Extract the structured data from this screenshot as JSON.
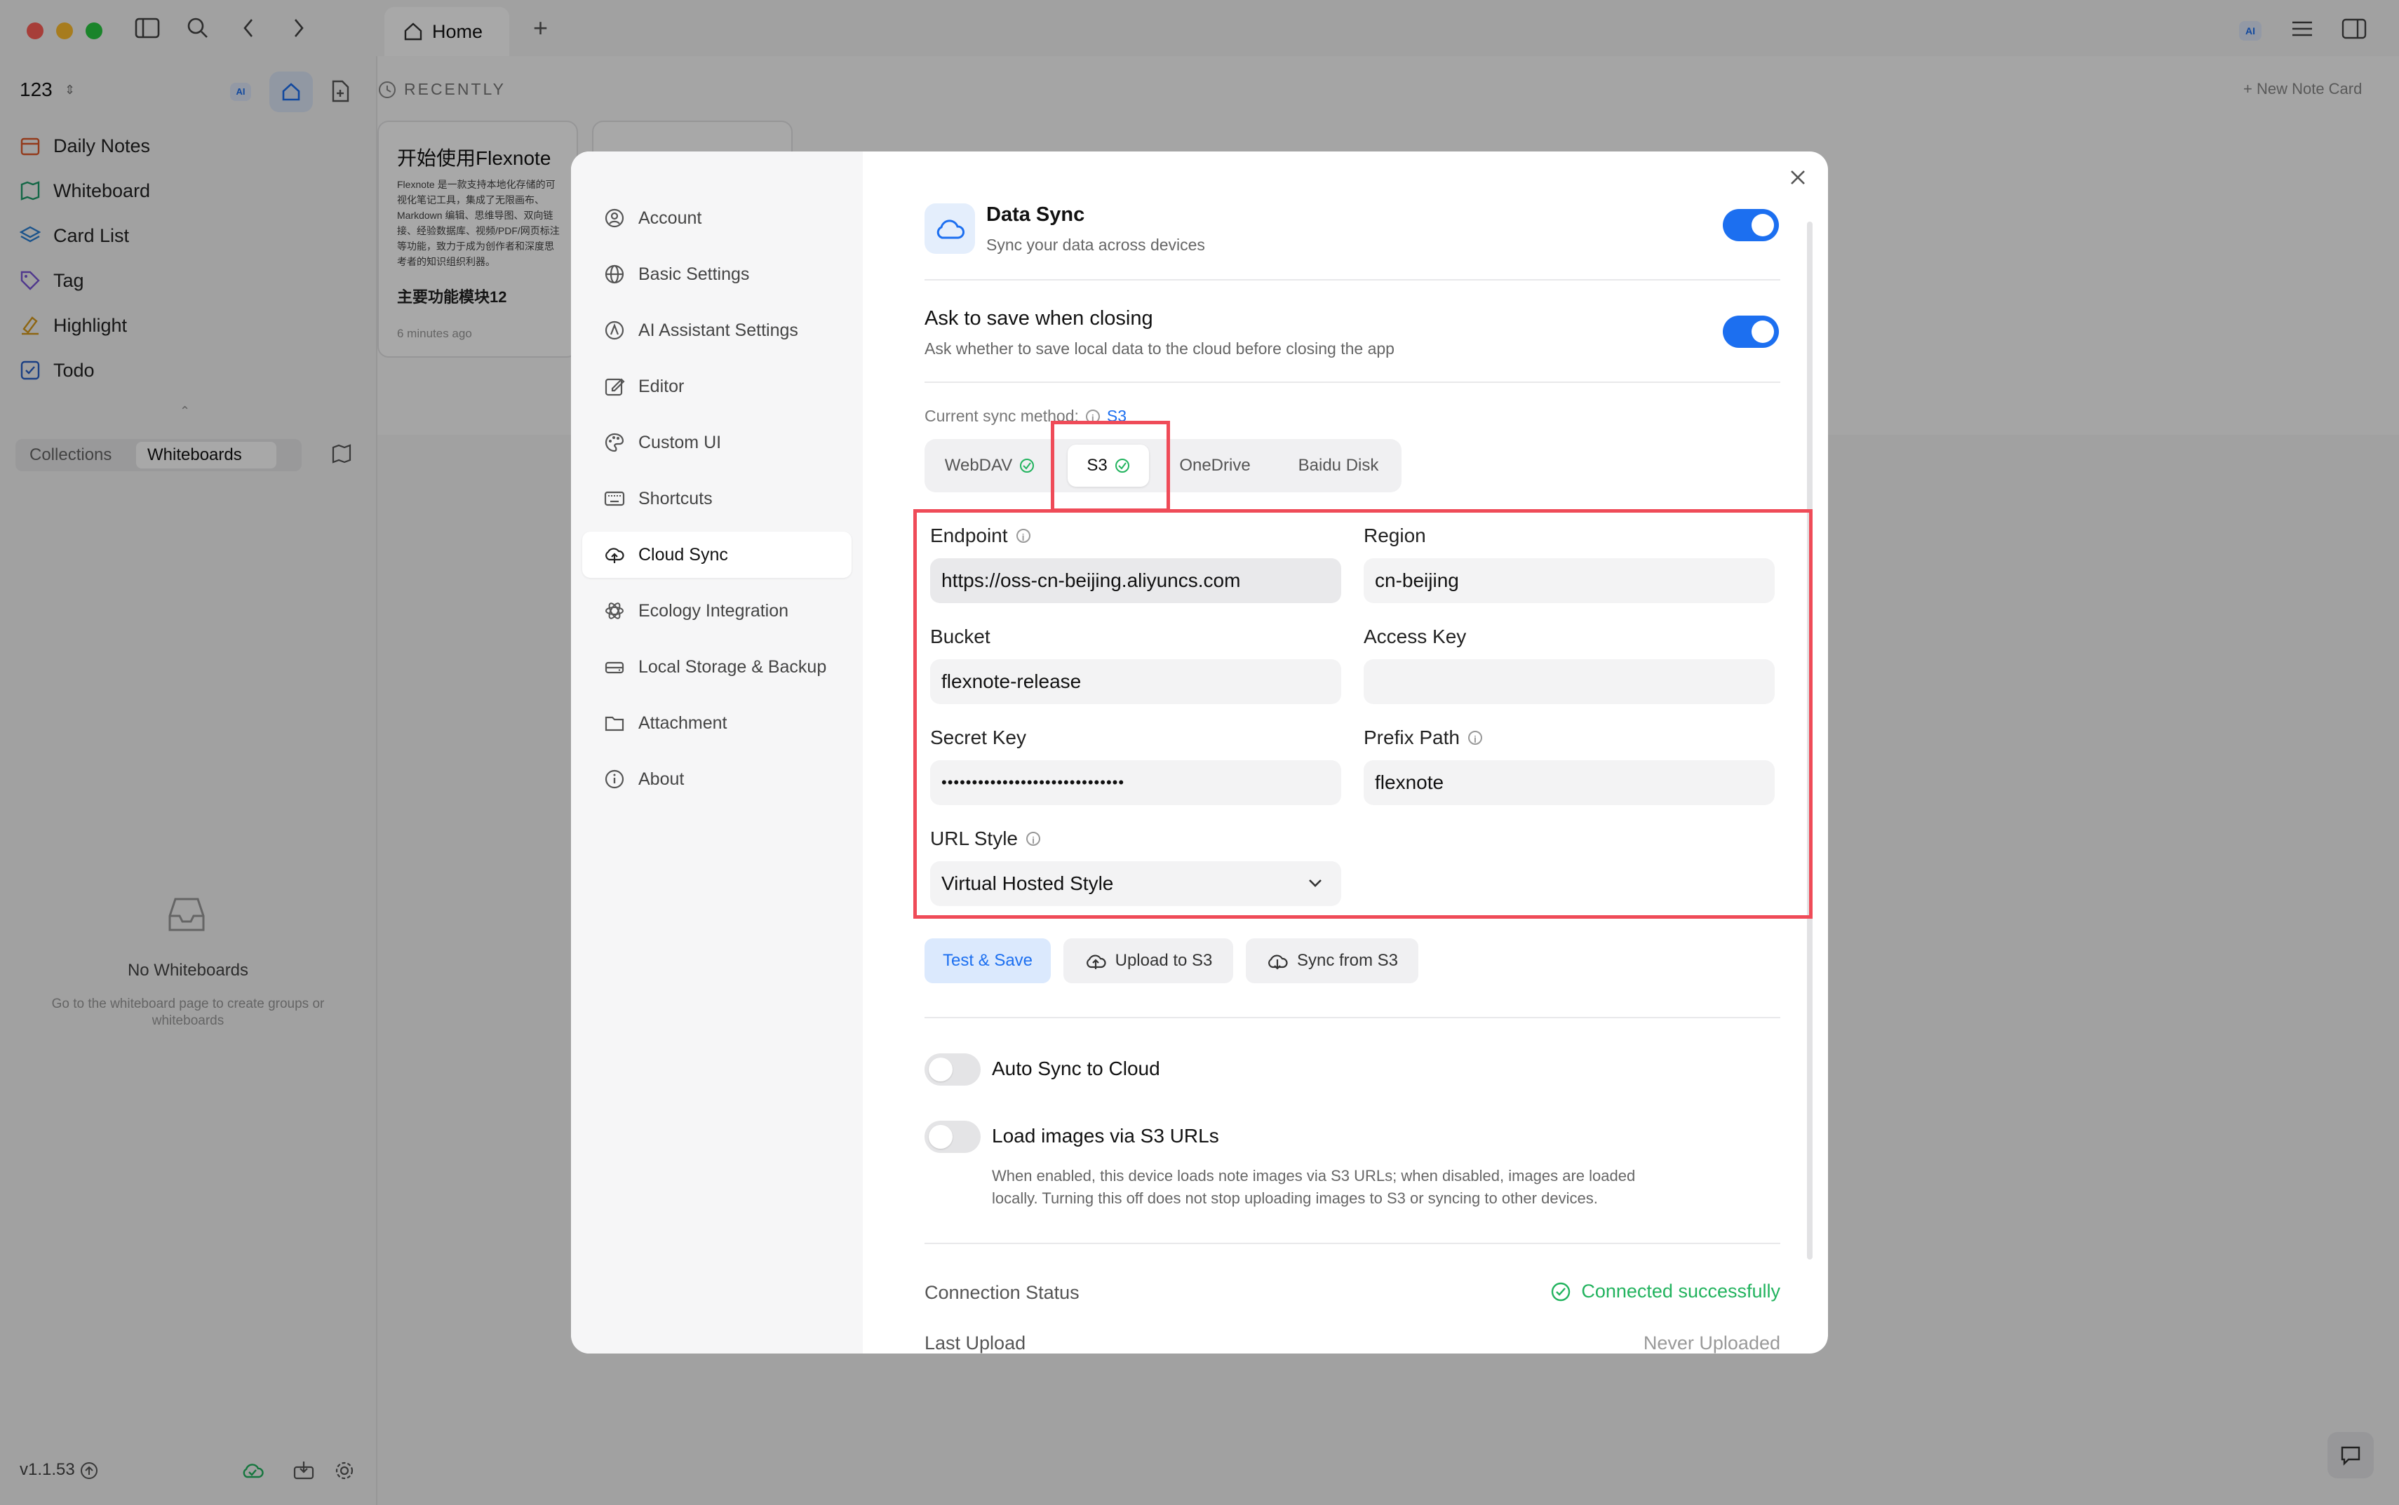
{
  "window": {
    "tab_home": "Home",
    "new_note_card": "+ New Note Card"
  },
  "sidebar": {
    "workspace": "123",
    "nav_items": [
      {
        "label": "Daily Notes",
        "icon": "calendar-icon"
      },
      {
        "label": "Whiteboard",
        "icon": "map-icon"
      },
      {
        "label": "Card List",
        "icon": "layers-icon"
      },
      {
        "label": "Tag",
        "icon": "tag-icon"
      },
      {
        "label": "Highlight",
        "icon": "highlighter-icon"
      },
      {
        "label": "Todo",
        "icon": "checkbox-icon"
      }
    ],
    "tabs": {
      "collections": "Collections",
      "whiteboards": "Whiteboards"
    },
    "empty_title": "No Whiteboards",
    "empty_desc": "Go to the whiteboard page to create groups or whiteboards",
    "version": "v1.1.53"
  },
  "main": {
    "recently_label": "RECENTLY",
    "card": {
      "title": "开始使用Flexnote",
      "body": "Flexnote 是一款支持本地化存储的可视化笔记工具，集成了无限画布、Markdown 编辑、思维导图、双向链接、经验数据库、视频/PDF/网页标注等功能，致力于成为创作者和深度思考者的知识组织利器。",
      "section": "主要功能模块12",
      "time": "6 minutes ago"
    }
  },
  "settings": {
    "menu": [
      {
        "label": "Account",
        "icon": "user-icon"
      },
      {
        "label": "Basic Settings",
        "icon": "globe-icon"
      },
      {
        "label": "AI Assistant Settings",
        "icon": "ai-icon"
      },
      {
        "label": "Editor",
        "icon": "edit-icon"
      },
      {
        "label": "Custom UI",
        "icon": "palette-icon"
      },
      {
        "label": "Shortcuts",
        "icon": "keyboard-icon"
      },
      {
        "label": "Cloud Sync",
        "icon": "cloud-upload-icon"
      },
      {
        "label": "Ecology Integration",
        "icon": "atom-icon"
      },
      {
        "label": "Local Storage & Backup",
        "icon": "drive-icon"
      },
      {
        "label": "Attachment",
        "icon": "folder-icon"
      },
      {
        "label": "About",
        "icon": "info-icon"
      }
    ],
    "data_sync": {
      "title": "Data Sync",
      "desc": "Sync your data across devices",
      "enabled": true
    },
    "ask_save": {
      "title": "Ask to save when closing",
      "desc": "Ask whether to save local data to the cloud before closing the app",
      "enabled": true
    },
    "current_method_label": "Current sync method:",
    "current_method_value": "S3",
    "methods": [
      {
        "label": "WebDAV",
        "checked": true
      },
      {
        "label": "S3",
        "checked": true
      },
      {
        "label": "OneDrive",
        "checked": false
      },
      {
        "label": "Baidu Disk",
        "checked": false
      }
    ],
    "form": {
      "endpoint_label": "Endpoint",
      "endpoint_value": "https://oss-cn-beijing.aliyuncs.com",
      "region_label": "Region",
      "region_value": "cn-beijing",
      "bucket_label": "Bucket",
      "bucket_value": "flexnote-release",
      "access_key_label": "Access Key",
      "access_key_value": "",
      "secret_key_label": "Secret Key",
      "secret_key_value": "••••••••••••••••••••••••••••••",
      "prefix_label": "Prefix Path",
      "prefix_value": "flexnote",
      "url_style_label": "URL Style",
      "url_style_value": "Virtual Hosted Style"
    },
    "buttons": {
      "test_save": "Test & Save",
      "upload": "Upload to S3",
      "sync_from": "Sync from S3"
    },
    "auto_sync": {
      "label": "Auto Sync to Cloud",
      "enabled": false
    },
    "load_images": {
      "label": "Load images via S3 URLs",
      "enabled": false,
      "desc_line1": "When enabled, this device loads note images via S3 URLs; when disabled, images are loaded",
      "desc_line2": "locally. Turning this off does not stop uploading images to S3 or syncing to other devices."
    },
    "status": {
      "connection_label": "Connection Status",
      "connection_value": "Connected successfully",
      "last_upload_label": "Last Upload",
      "last_upload_value": "Never Uploaded"
    },
    "colors": {
      "accent": "#1c6ff0",
      "success": "#22b35e",
      "highlight": "#ef4b58"
    }
  }
}
